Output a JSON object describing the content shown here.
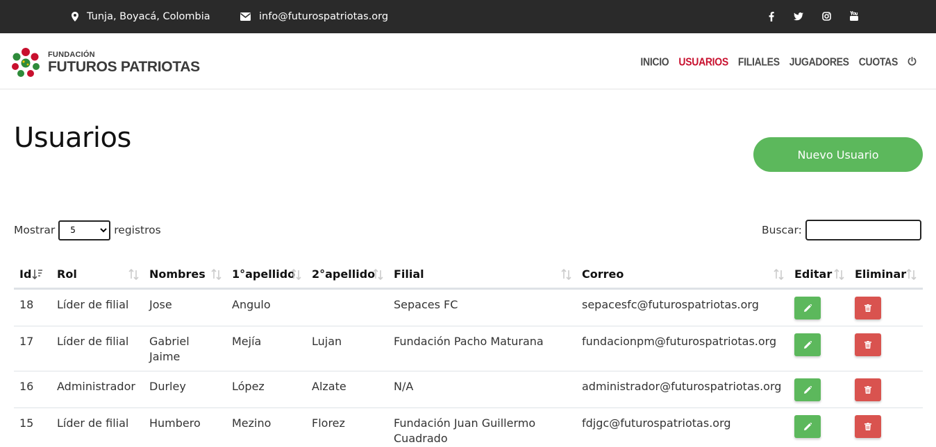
{
  "topbar": {
    "location": "Tunja, Boyacá, Colombia",
    "email": "info@futurospatriotas.org",
    "social_icons": [
      "facebook-icon",
      "twitter-icon",
      "instagram-icon",
      "youtube-icon"
    ]
  },
  "brand": {
    "top": "FUNDACIÓN",
    "main": "FUTUROS PATRIOTAS"
  },
  "nav": {
    "items": [
      "INICIO",
      "USUARIOS",
      "FILIALES",
      "JUGADORES",
      "CUOTAS"
    ],
    "active": "USUARIOS",
    "active_color": "#c8102e"
  },
  "page": {
    "title": "Usuarios",
    "new_button": "Nuevo Usuario"
  },
  "controls": {
    "show_prefix": "Mostrar",
    "show_value": "5",
    "show_suffix": "registros",
    "search_label": "Buscar:"
  },
  "table": {
    "columns": [
      "Id",
      "Rol",
      "Nombres",
      "1°apellido",
      "2°apellido",
      "Filial",
      "Correo",
      "Editar",
      "Eliminar"
    ],
    "rows": [
      [
        "18",
        "Líder de filial",
        "Jose",
        "Angulo",
        "",
        "Sepaces FC",
        "sepacesfc@futurospatriotas.org"
      ],
      [
        "17",
        "Líder de filial",
        "Gabriel Jaime",
        "Mejía",
        "Lujan",
        "Fundación Pacho Maturana",
        "fundacionpm@futurospatriotas.org"
      ],
      [
        "16",
        "Administrador",
        "Durley",
        "López",
        "Alzate",
        "N/A",
        "administrador@futurospatriotas.org"
      ],
      [
        "15",
        "Líder de filial",
        "Humbero",
        "Mezino",
        "Florez",
        "Fundación Juan Guillermo Cuadrado",
        "fdjgc@futurospatriotas.org"
      ]
    ]
  },
  "colors": {
    "topbar": "#2a2a2a",
    "success": "#5cb85c",
    "danger": "#d9534f"
  }
}
